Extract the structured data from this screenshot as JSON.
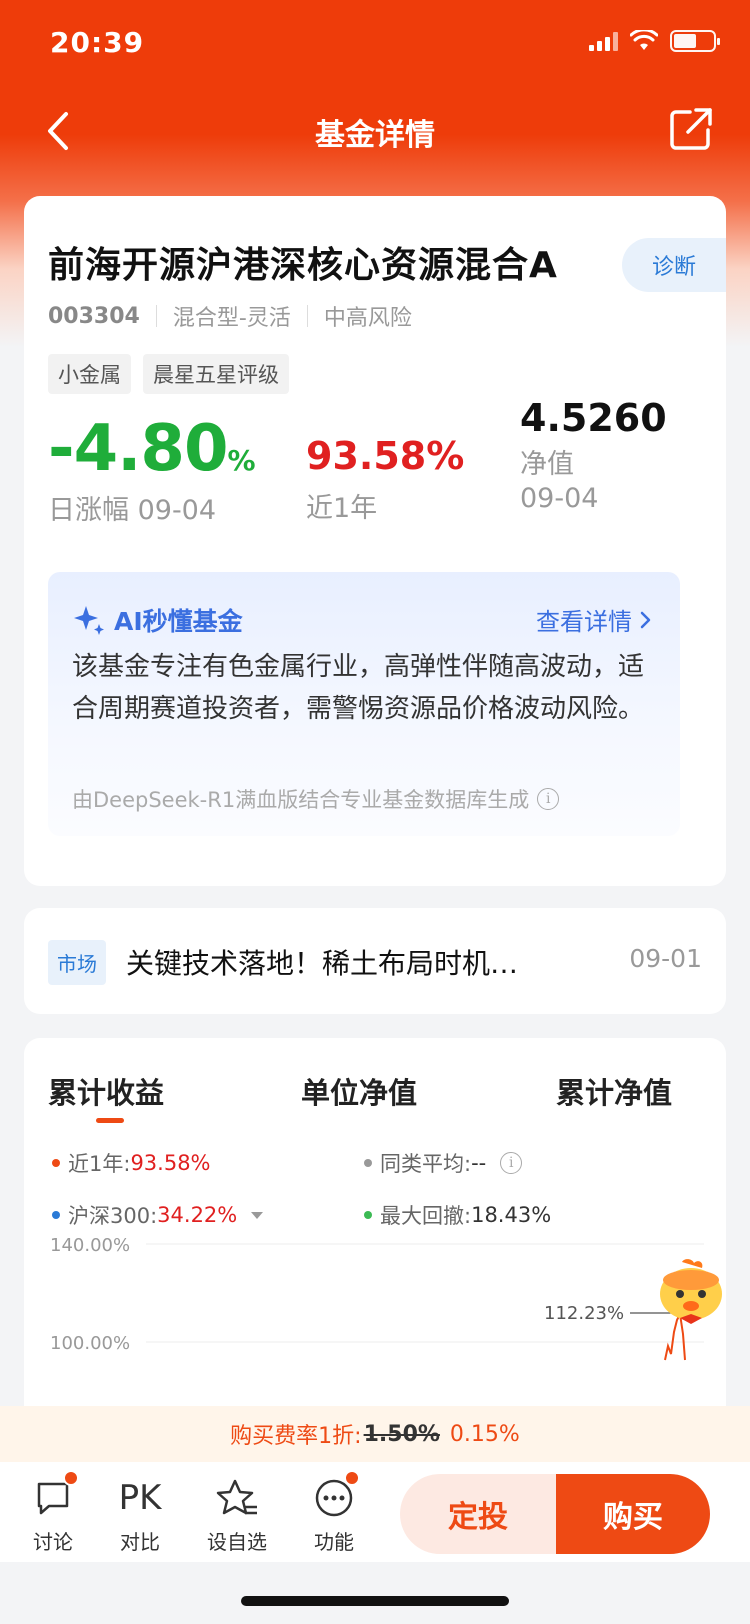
{
  "status_bar": {
    "time": "20:39"
  },
  "nav": {
    "title": "基金详情"
  },
  "fund": {
    "name": "前海开源沪港深核心资源混合A",
    "diagnose_label": "诊断",
    "code": "003304",
    "type": "混合型-灵活",
    "risk": "中高风险",
    "tags": [
      "小金属",
      "晨星五星评级"
    ],
    "daily_change": "-4.80",
    "daily_change_unit": "%",
    "daily_change_label": "日涨幅 09-04",
    "one_year_return": "93.58%",
    "one_year_label": "近1年",
    "nav_value": "4.5260",
    "nav_label": "净值",
    "nav_date": "09-04",
    "colors": {
      "down": "#1fad3a",
      "up": "#e02020"
    }
  },
  "ai": {
    "title": "AI秒懂基金",
    "link": "查看详情",
    "text": "该基金专注有色金属行业，高弹性伴随高波动，适合周期赛道投资者，需警惕资源品价格波动风险。",
    "footer": "由DeepSeek-R1满血版结合专业基金数据库生成"
  },
  "news": {
    "tag": "市场",
    "title": "关键技术落地！稀土布局时机…",
    "date": "09-01"
  },
  "chart_tabs": [
    "累计收益",
    "单位净值",
    "累计净值"
  ],
  "chart_legend": {
    "fund": {
      "label": "近1年:",
      "value": "93.58%"
    },
    "peer": {
      "label": "同类平均:",
      "value": "--"
    },
    "index": {
      "label": "沪深300:",
      "value": "34.22%"
    },
    "drawdown": {
      "label": "最大回撤:",
      "value": "18.43%"
    }
  },
  "chart_data": {
    "type": "line",
    "y_ticks": [
      "140.00%",
      "100.00%"
    ],
    "annotation": "112.23%",
    "series": [
      {
        "name": "近1年",
        "color": "#ee4a14"
      }
    ]
  },
  "fee": {
    "prefix": "购买费率1折:",
    "old_rate": "1.50%",
    "new_rate": "0.15%"
  },
  "bottom": {
    "items": [
      "讨论",
      "对比",
      "设自选",
      "功能"
    ],
    "pk_label": "PK",
    "invest_label": "定投",
    "buy_label": "购买"
  }
}
